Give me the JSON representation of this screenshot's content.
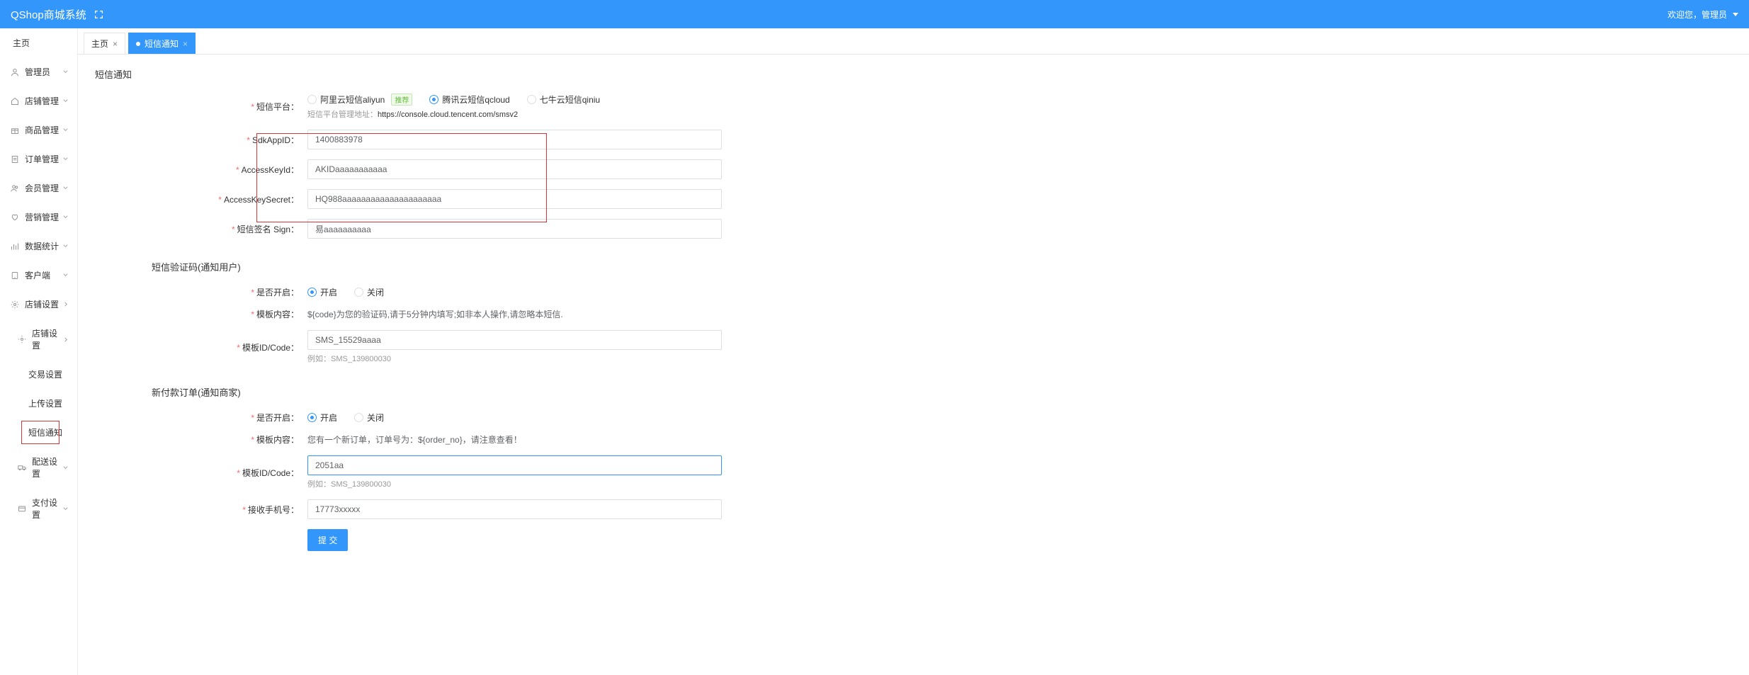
{
  "header": {
    "title": "QShop商城系统",
    "welcome": "欢迎您，管理员"
  },
  "sidebar": {
    "home": "主页",
    "items": [
      {
        "label": "管理员",
        "icon": "user"
      },
      {
        "label": "店铺管理",
        "icon": "home"
      },
      {
        "label": "商品管理",
        "icon": "gift"
      },
      {
        "label": "订单管理",
        "icon": "order"
      },
      {
        "label": "会员管理",
        "icon": "member"
      },
      {
        "label": "营销管理",
        "icon": "heart"
      },
      {
        "label": "数据统计",
        "icon": "chart"
      },
      {
        "label": "客户端",
        "icon": "client"
      }
    ],
    "shopSettings": {
      "label": "店铺设置",
      "icon": "gear",
      "sub": {
        "label": "店铺设置",
        "children": [
          {
            "label": "交易设置"
          },
          {
            "label": "上传设置"
          },
          {
            "label": "短信通知",
            "highlighted": true
          }
        ]
      },
      "others": [
        {
          "label": "配送设置",
          "icon": "truck"
        },
        {
          "label": "支付设置",
          "icon": "wallet"
        }
      ]
    }
  },
  "tabs": [
    {
      "label": "主页",
      "active": false
    },
    {
      "label": "短信通知",
      "active": true
    }
  ],
  "form": {
    "section1": {
      "title": "短信通知",
      "platform": {
        "label": "短信平台：",
        "options": [
          {
            "label": "阿里云短信aliyun",
            "badge": "推荐"
          },
          {
            "label": "腾讯云短信qcloud",
            "checked": true
          },
          {
            "label": "七牛云短信qiniu"
          }
        ],
        "hint_prefix": "短信平台管理地址：",
        "hint_url": "https://console.cloud.tencent.com/smsv2"
      },
      "sdkAppId": {
        "label": "SdkAppID：",
        "value": "1400883978"
      },
      "accessKeyId": {
        "label": "AccessKeyId：",
        "value": "AKIDaaaaaaaaaaa"
      },
      "accessKeySecret": {
        "label": "AccessKeySecret：",
        "value": "HQ988aaaaaaaaaaaaaaaaaaaaa"
      },
      "sign": {
        "label": "短信签名 Sign：",
        "value": "易aaaaaaaaaa"
      }
    },
    "section2": {
      "title": "短信验证码(通知用户)",
      "enable": {
        "label": "是否开启：",
        "on": "开启",
        "off": "关闭"
      },
      "template": {
        "label": "模板内容：",
        "value": "${code}为您的验证码,请于5分钟内填写;如非本人操作,请忽略本短信."
      },
      "templateId": {
        "label": "模板ID/Code：",
        "value": "SMS_15529aaaa",
        "hint": "例如：SMS_139800030"
      }
    },
    "section3": {
      "title": "新付款订单(通知商家)",
      "enable": {
        "label": "是否开启：",
        "on": "开启",
        "off": "关闭"
      },
      "template": {
        "label": "模板内容：",
        "value": "您有一个新订单，订单号为：${order_no}，请注意查看！"
      },
      "templateId": {
        "label": "模板ID/Code：",
        "value": "2051aa",
        "hint": "例如：SMS_139800030"
      },
      "phone": {
        "label": "接收手机号：",
        "value": "17773xxxxx"
      }
    },
    "submit": "提 交"
  }
}
